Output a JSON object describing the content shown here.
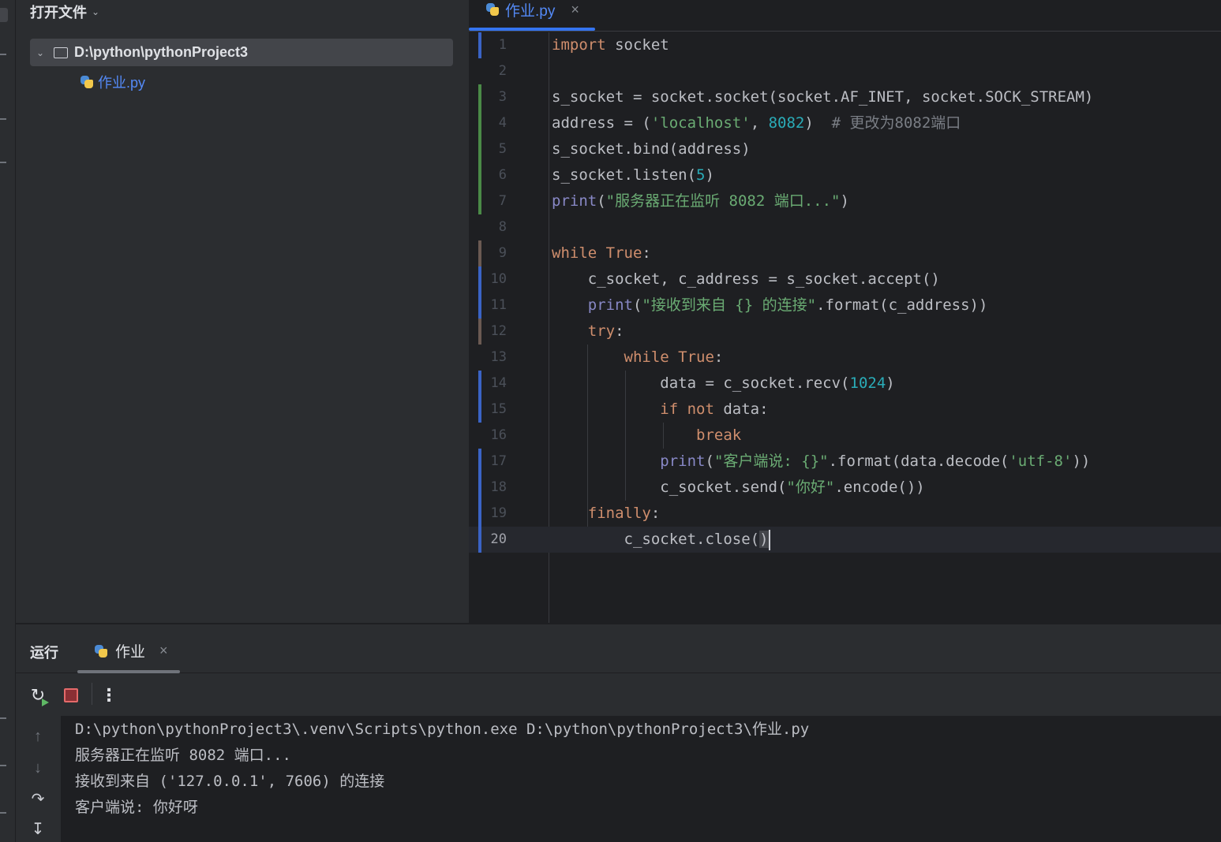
{
  "project": {
    "title": "打开文件",
    "root_label": "D:\\python\\pythonProject3",
    "file_label": "作业.py"
  },
  "editor": {
    "tab_label": "作业.py",
    "close": "×",
    "lines": [
      {
        "n": "1",
        "m": "mod"
      },
      {
        "n": "2",
        "m": ""
      },
      {
        "n": "3",
        "m": "add"
      },
      {
        "n": "4",
        "m": "add"
      },
      {
        "n": "5",
        "m": "add"
      },
      {
        "n": "6",
        "m": "add"
      },
      {
        "n": "7",
        "m": "add"
      },
      {
        "n": "8",
        "m": ""
      },
      {
        "n": "9",
        "m": "note"
      },
      {
        "n": "10",
        "m": "mod"
      },
      {
        "n": "11",
        "m": "mod"
      },
      {
        "n": "12",
        "m": "note"
      },
      {
        "n": "13",
        "m": ""
      },
      {
        "n": "14",
        "m": "mod"
      },
      {
        "n": "15",
        "m": "mod"
      },
      {
        "n": "16",
        "m": ""
      },
      {
        "n": "17",
        "m": "mod"
      },
      {
        "n": "18",
        "m": "mod"
      },
      {
        "n": "19",
        "m": "mod"
      },
      {
        "n": "20",
        "m": "mod"
      }
    ],
    "code": {
      "l1_kw": "import",
      "l1_rest": " socket",
      "l3": "s_socket = socket.socket(socket.AF_INET, socket.SOCK_STREAM)",
      "l4_a": "address = (",
      "l4_str": "'localhost'",
      "l4_b": ", ",
      "l4_num": "8082",
      "l4_c": ")  ",
      "l4_cmt": "# 更改为8082端口",
      "l5": "s_socket.bind(address)",
      "l6_a": "s_socket.listen(",
      "l6_num": "5",
      "l6_b": ")",
      "l7_fn": "print",
      "l7_a": "(",
      "l7_str": "\"服务器正在监听 8082 端口...\"",
      "l7_b": ")",
      "l9_kw": "while True",
      "l9_b": ":",
      "l10": "    c_socket, c_address = s_socket.accept()",
      "l11_ind": "    ",
      "l11_fn": "print",
      "l11_a": "(",
      "l11_str": "\"接收到来自 {} 的连接\"",
      "l11_b": ".format(c_address))",
      "l12_ind": "    ",
      "l12_kw": "try",
      "l12_b": ":",
      "l13_ind": "        ",
      "l13_kw": "while True",
      "l13_b": ":",
      "l14_a": "            data = c_socket.recv(",
      "l14_num": "1024",
      "l14_b": ")",
      "l15_ind": "            ",
      "l15_kw": "if not",
      "l15_b": " data:",
      "l16_ind": "                ",
      "l16_kw": "break",
      "l17_ind": "            ",
      "l17_fn": "print",
      "l17_a": "(",
      "l17_str": "\"客户端说: {}\"",
      "l17_b": ".format(data.decode(",
      "l17_str2": "'utf-8'",
      "l17_c": "))",
      "l18_a": "            c_socket.send(",
      "l18_str": "\"你好\"",
      "l18_b": ".encode())",
      "l19_ind": "    ",
      "l19_kw": "finally",
      "l19_b": ":",
      "l20_a": "        c_socket.close(",
      "l20_b": ")"
    }
  },
  "run": {
    "title": "运行",
    "tab_label": "作业",
    "close": "×",
    "console": [
      "D:\\python\\pythonProject3\\.venv\\Scripts\\python.exe D:\\python\\pythonProject3\\作业.py",
      "服务器正在监听 8082 端口...",
      "接收到来自 ('127.0.0.1', 7606) 的连接",
      "客户端说: 你好呀"
    ]
  },
  "colors": {
    "accent": "#3574f0",
    "keyword": "#cf8e6d",
    "string": "#6aab73",
    "number": "#2aacb8",
    "builtin": "#8888c6"
  }
}
